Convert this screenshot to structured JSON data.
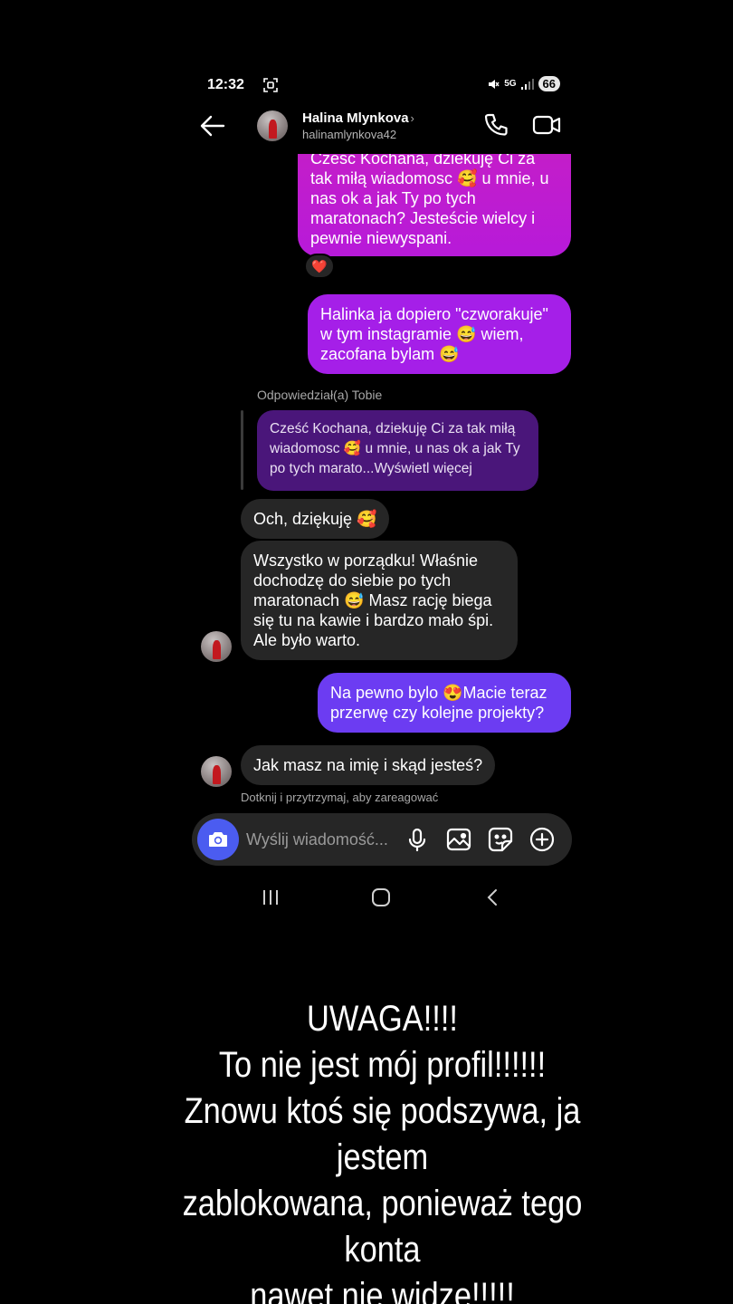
{
  "status_bar": {
    "time": "12:32",
    "network": "5G",
    "battery": "66"
  },
  "header": {
    "name": "Halina Mlynkova",
    "chevron": "›",
    "username": "halinamlynkova42"
  },
  "messages": [
    {
      "sender": "me",
      "text": "Cześć Kochana, dziekuję Ci za tak miłą wiadomosc 🥰 u mnie, u nas ok a jak Ty po tych maratonach? Jesteście wielcy i pewnie niewyspani.",
      "reaction": "❤️"
    },
    {
      "sender": "me",
      "text": "Halinka ja dopiero \"czworakuje\" w tym instagramie 😅 wiem, zacofana bylam 😅"
    },
    {
      "sender": "them",
      "reply_label": "Odpowiedział(a) Tobie",
      "quoted": "Cześć Kochana, dziekuję Ci za tak miłą wiadomosc 🥰 u mnie, u nas ok a jak Ty po tych marato...Wyświetl więcej"
    },
    {
      "sender": "them",
      "text": "Och, dziękuję 🥰"
    },
    {
      "sender": "them",
      "text": "Wszystko w porządku! Właśnie dochodzę do siebie po tych maratonach 😅 Masz rację  biega się tu na kawie i bardzo mało śpi. Ale było warto."
    },
    {
      "sender": "me",
      "text": "Na pewno bylo 😍Macie teraz przerwę czy kolejne projekty?"
    },
    {
      "sender": "them",
      "text": "Jak masz na imię i skąd jesteś?"
    }
  ],
  "hint": "Dotknij i przytrzymaj, aby zareagować",
  "composer": {
    "placeholder": "Wyślij wiadomość..."
  },
  "icons": {
    "back": "arrow-left-icon",
    "call": "phone-icon",
    "video": "video-camera-icon",
    "camera": "camera-icon",
    "mic": "microphone-icon",
    "gallery": "image-icon",
    "sticker": "sticker-icon",
    "add": "plus-circle-icon"
  },
  "colors": {
    "bubble_me_1": "#c51ec7",
    "bubble_me_2": "#a51fe8",
    "bubble_me_3": "#6c3cf2",
    "bubble_them": "#262626",
    "reply_quote": "#4a167a",
    "camera_button": "#4b5cf0"
  },
  "warning": {
    "line1": "UWAGA!!!!",
    "line2": "To nie jest mój profil!!!!!!",
    "line3": "Znowu ktoś się podszywa, ja jestem",
    "line4": "zablokowana, ponieważ tego konta",
    "line5": "nawet nie widzę!!!!!"
  }
}
